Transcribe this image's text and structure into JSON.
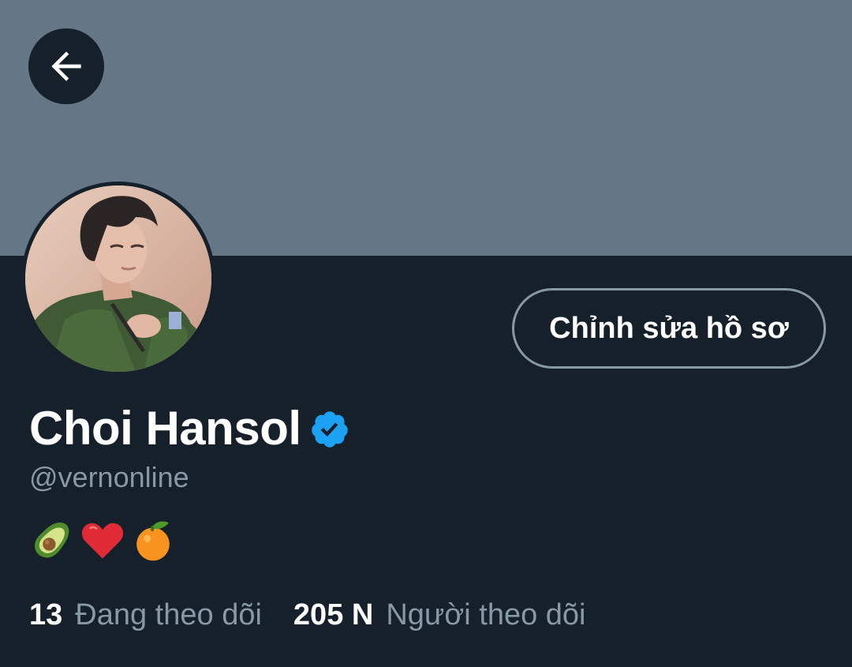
{
  "profile": {
    "name": "Choi Hansol",
    "handle": "@vernonline",
    "verified": true,
    "edit_label": "Chỉnh sửa hồ sơ",
    "bio_emojis": [
      "avocado-emoji",
      "red-heart-emoji",
      "tangerine-emoji"
    ]
  },
  "stats": {
    "following_count": "13",
    "following_label": "Đang theo dõi",
    "followers_count": "205 N",
    "followers_label": "Người theo dõi"
  },
  "icons": {
    "back": "back-arrow-icon",
    "verified": "verified-badge-icon"
  },
  "colors": {
    "background": "#15202b",
    "banner": "#657786",
    "secondary_text": "#8899a6",
    "verified_blue": "#1da1f2",
    "button_border": "#8899a6"
  }
}
